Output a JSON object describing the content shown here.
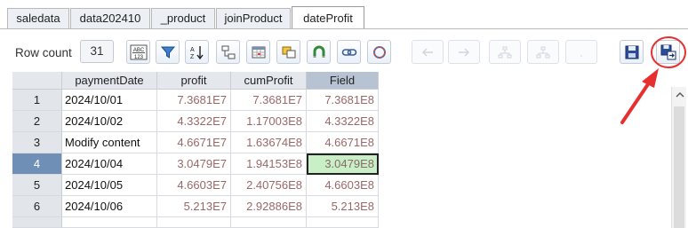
{
  "tabs": [
    {
      "label": "saledata",
      "active": false
    },
    {
      "label": "data202410",
      "active": false
    },
    {
      "label": "_product",
      "active": false
    },
    {
      "label": "joinProduct",
      "active": false
    },
    {
      "label": "dateProfit",
      "active": true
    }
  ],
  "toolbar": {
    "row_count_label": "Row count",
    "row_count_value": "31",
    "icons": [
      "abc-123-icon",
      "filter-icon",
      "sort-az-icon",
      "link-rows-icon",
      "grid-table-icon",
      "copy-layers-icon",
      "magnet-icon",
      "chain-link-icon",
      "dotted-circle-icon",
      "arrow-left-icon",
      "arrow-right-icon",
      "tree-up-icon",
      "tree-down-icon",
      "blank-icon",
      "save-icon",
      "save-as-icon"
    ],
    "highlight_color": "#e63030"
  },
  "grid": {
    "columns": [
      "paymentDate",
      "profit",
      "cumProfit",
      "Field"
    ],
    "selected_column": "Field",
    "rows": [
      {
        "index": "1",
        "paymentDate": "2024/10/01",
        "profit": "7.3681E7",
        "cumProfit": "7.3681E7",
        "field": "7.3681E8"
      },
      {
        "index": "2",
        "paymentDate": "2024/10/02",
        "profit": "4.3322E7",
        "cumProfit": "1.17003E8",
        "field": "4.3322E8"
      },
      {
        "index": "3",
        "paymentDate": "Modify content",
        "profit": "4.6671E7",
        "cumProfit": "1.63674E8",
        "field": "4.6671E8"
      },
      {
        "index": "4",
        "paymentDate": "2024/10/04",
        "profit": "3.0479E7",
        "cumProfit": "1.94153E8",
        "field": "3.0479E8"
      },
      {
        "index": "5",
        "paymentDate": "2024/10/05",
        "profit": "4.6603E7",
        "cumProfit": "2.40756E8",
        "field": "4.6603E8"
      },
      {
        "index": "6",
        "paymentDate": "2024/10/06",
        "profit": "5.213E7",
        "cumProfit": "2.92886E8",
        "field": "5.213E8"
      }
    ],
    "selected_row": "4",
    "colors": {
      "numeric_text": "#9a6868",
      "current_cell_bg": "#c8efc6",
      "selected_row_header": "#6f8fb7"
    }
  }
}
